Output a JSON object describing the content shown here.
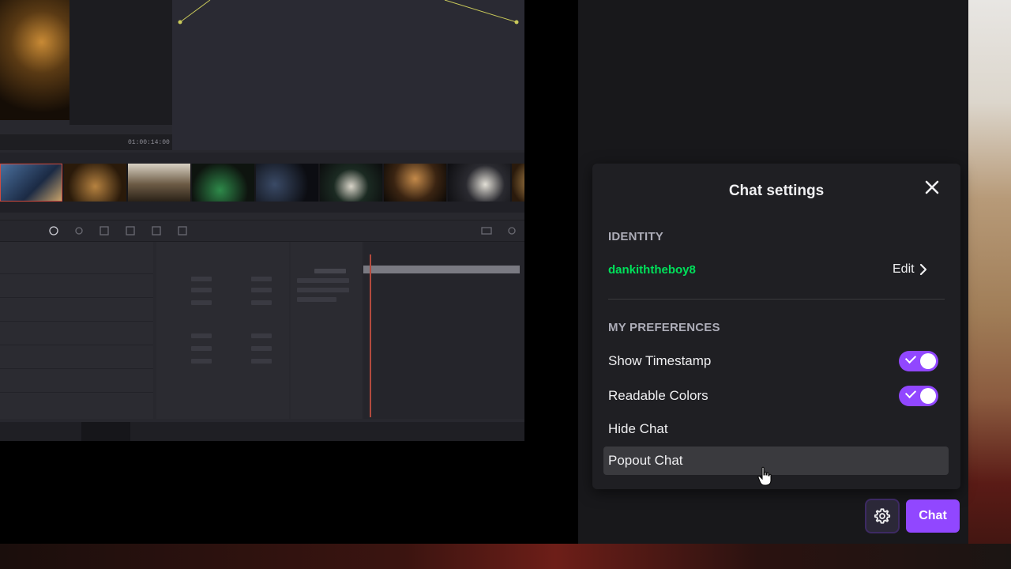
{
  "editor": {
    "timecode": "01:00:14:00"
  },
  "chat_settings": {
    "title": "Chat settings",
    "close_icon": "close-icon",
    "identity": {
      "label": "IDENTITY",
      "username": "dankiththeboy8",
      "username_color": "#00e05a",
      "edit_label": "Edit"
    },
    "preferences": {
      "label": "MY PREFERENCES",
      "items": [
        {
          "label": "Show Timestamp",
          "toggle": true,
          "on": true
        },
        {
          "label": "Readable Colors",
          "toggle": true,
          "on": true
        },
        {
          "label": "Hide Chat",
          "toggle": false
        },
        {
          "label": "Popout Chat",
          "toggle": false,
          "hovered": true
        }
      ]
    }
  },
  "footer": {
    "settings_icon": "gear-icon",
    "chat_button_label": "Chat"
  },
  "colors": {
    "accent": "#9147ff",
    "panel": "#1f1f23",
    "column": "#18181b"
  }
}
